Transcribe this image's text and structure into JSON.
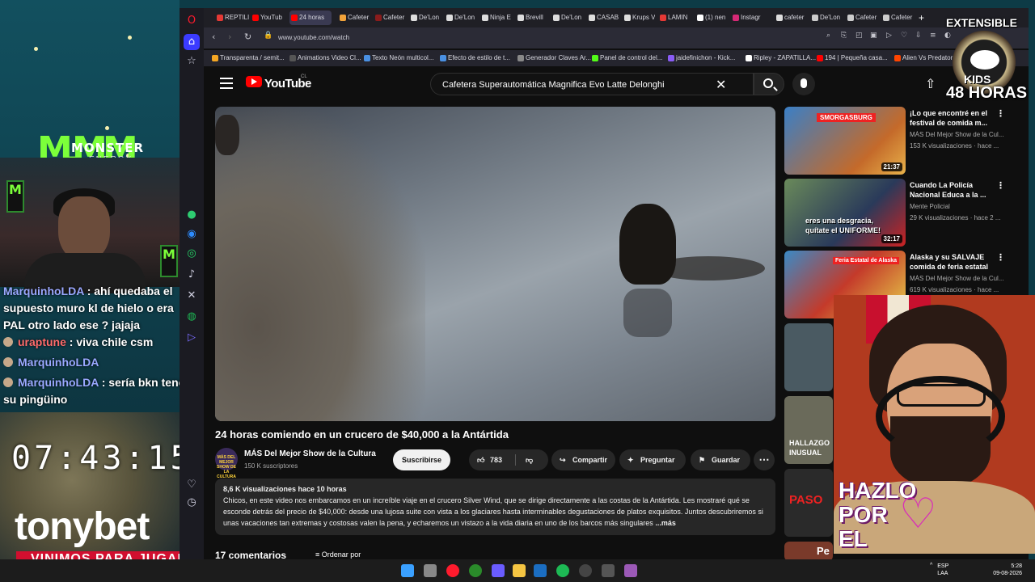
{
  "overlay": {
    "sponsor_logo": "MONSTER",
    "sponsor_sub": "ENERGY",
    "chat": [
      {
        "user": "MarquinhoLDA",
        "text": ": ahí quedaba el supuesto muro kl de hielo o era PAL otro lado ese ? jajaja"
      },
      {
        "user": "uraptune",
        "text": ": viva chile csm"
      },
      {
        "user": "MarquinhoLDA",
        "text": ""
      },
      {
        "user": "MarquinhoLDA",
        "text": ": sería bkn tener su pingüino"
      }
    ],
    "clock": "07:43:15",
    "brand": "tonybet",
    "banner": "VINIMOS PARA JUGAR",
    "extensible_title": "EXTENSIBLE",
    "extensible_kids": "KIDS",
    "extensible_hours": "48 HORAS",
    "promo_line1": "HAZLO",
    "promo_line2": "POR",
    "promo_line3": "EL"
  },
  "browser": {
    "tabs": [
      {
        "label": "REPTILI",
        "color": "#e53935"
      },
      {
        "label": "YouTub",
        "color": "#ff0000"
      },
      {
        "label": "24 horas",
        "color": "#ff0000"
      },
      {
        "label": "Cafeter",
        "color": "#f2a33a"
      },
      {
        "label": "Cafeter",
        "color": "#8a1c1c"
      },
      {
        "label": "De'Lon",
        "color": "#dddddd"
      },
      {
        "label": "De'Lon",
        "color": "#dddddd"
      },
      {
        "label": "Ninja E",
        "color": "#dddddd"
      },
      {
        "label": "Brevill",
        "color": "#dddddd"
      },
      {
        "label": "De'Lon",
        "color": "#dddddd"
      },
      {
        "label": "CASAB",
        "color": "#dddddd"
      },
      {
        "label": "Krups V",
        "color": "#dddddd"
      },
      {
        "label": "LAMIN",
        "color": "#e53935"
      },
      {
        "label": "(1) nen",
        "color": "#ffffff"
      },
      {
        "label": "Instagr",
        "color": "#d62976"
      },
      {
        "label": "cafeter",
        "color": "#dddddd"
      },
      {
        "label": "De'Lon",
        "color": "#cccccc"
      },
      {
        "label": "Cafeter",
        "color": "#cccccc"
      },
      {
        "label": "Cafeter",
        "color": "#cccccc"
      }
    ],
    "url": "www.youtube.com/watch",
    "bookmarks": [
      {
        "label": "Transparenta / semit...",
        "color": "#f5a623"
      },
      {
        "label": "Animations Video Cl...",
        "color": "#555555"
      },
      {
        "label": "Texto Neón multicol...",
        "color": "#4a90e2"
      },
      {
        "label": "Efecto de estilo de t...",
        "color": "#4a90e2"
      },
      {
        "label": "Generador Claves Ar...",
        "color": "#888888"
      },
      {
        "label": "Panel de control del...",
        "color": "#53fc18"
      },
      {
        "label": "jaidefinichon - Kick...",
        "color": "#8a5cf6"
      },
      {
        "label": "Ripley - ZAPATILLA...",
        "color": "#ffffff"
      },
      {
        "label": "194 | Pequeña casa...",
        "color": "#ff0000"
      },
      {
        "label": "Alien Vs Predator...",
        "color": "#ff4500"
      }
    ]
  },
  "youtube": {
    "logo_text": "YouTube",
    "region": "CL",
    "search_value": "Cafetera Superautomática Magnifica Evo Latte Delonghi",
    "video_title": "24 horas comiendo en un crucero de $40,000 a la Antártida",
    "channel_name": "MÁS Del Mejor Show de la Cultura",
    "channel_avatar_text": "MÁS DEL MEJOR SHOW DE LA CULTURA",
    "subscribers": "150 K suscriptores",
    "subscribe_label": "Suscribirse",
    "likes": "783",
    "share_label": "Compartir",
    "ask_label": "Preguntar",
    "save_label": "Guardar",
    "desc_meta": "8,6 K visualizaciones  hace 10 horas",
    "desc_text": "Chicos, en este video nos embarcamos en un increíble viaje en el crucero Silver Wind, que se dirige directamente a las costas de la Antártida. Les mostraré qué se esconde detrás del precio de $40,000: desde una lujosa suite con vista a los glaciares hasta interminables degustaciones de platos exquisitos. Juntos descubriremos si unas vacaciones tan extremas y costosas valen la pena, y echaremos un vistazo a la vida diaria en uno de los barcos más singulares",
    "desc_more": "...más",
    "comments_title": "17 comentarios",
    "sort_label": "Ordenar por",
    "recommended": [
      {
        "title": "¡Lo que encontré en el festival de comida m...",
        "channel": "MÁS Del Mejor Show de la Cul...",
        "views": "153 K visualizaciones · hace ...",
        "duration": "21:37",
        "thumb_text": "SMORGASBURG"
      },
      {
        "title": "Cuando La Policía Nacional Educa a la ...",
        "channel": "Mente Policial",
        "views": "29 K visualizaciones · hace 2 ...",
        "duration": "32:17",
        "thumb_text": "eres una desgracia, quítate el UNIFORME!"
      },
      {
        "title": "Alaska y su SALVAJE comida de feria estatal",
        "channel": "MÁS Del Mejor Show de la Cul...",
        "views": "619 K visualizaciones · hace ...",
        "duration": "",
        "thumb_text": "Feria Estatal de Alaska"
      }
    ],
    "rec_small": [
      {
        "text": ""
      },
      {
        "text": "HALLAZGO INUSUAL"
      },
      {
        "text": "PASO"
      },
      {
        "text": "Pe"
      }
    ]
  },
  "taskbar": {
    "lang": "ESP\nLAA",
    "time": "5:28",
    "date": "09-08-2026"
  }
}
